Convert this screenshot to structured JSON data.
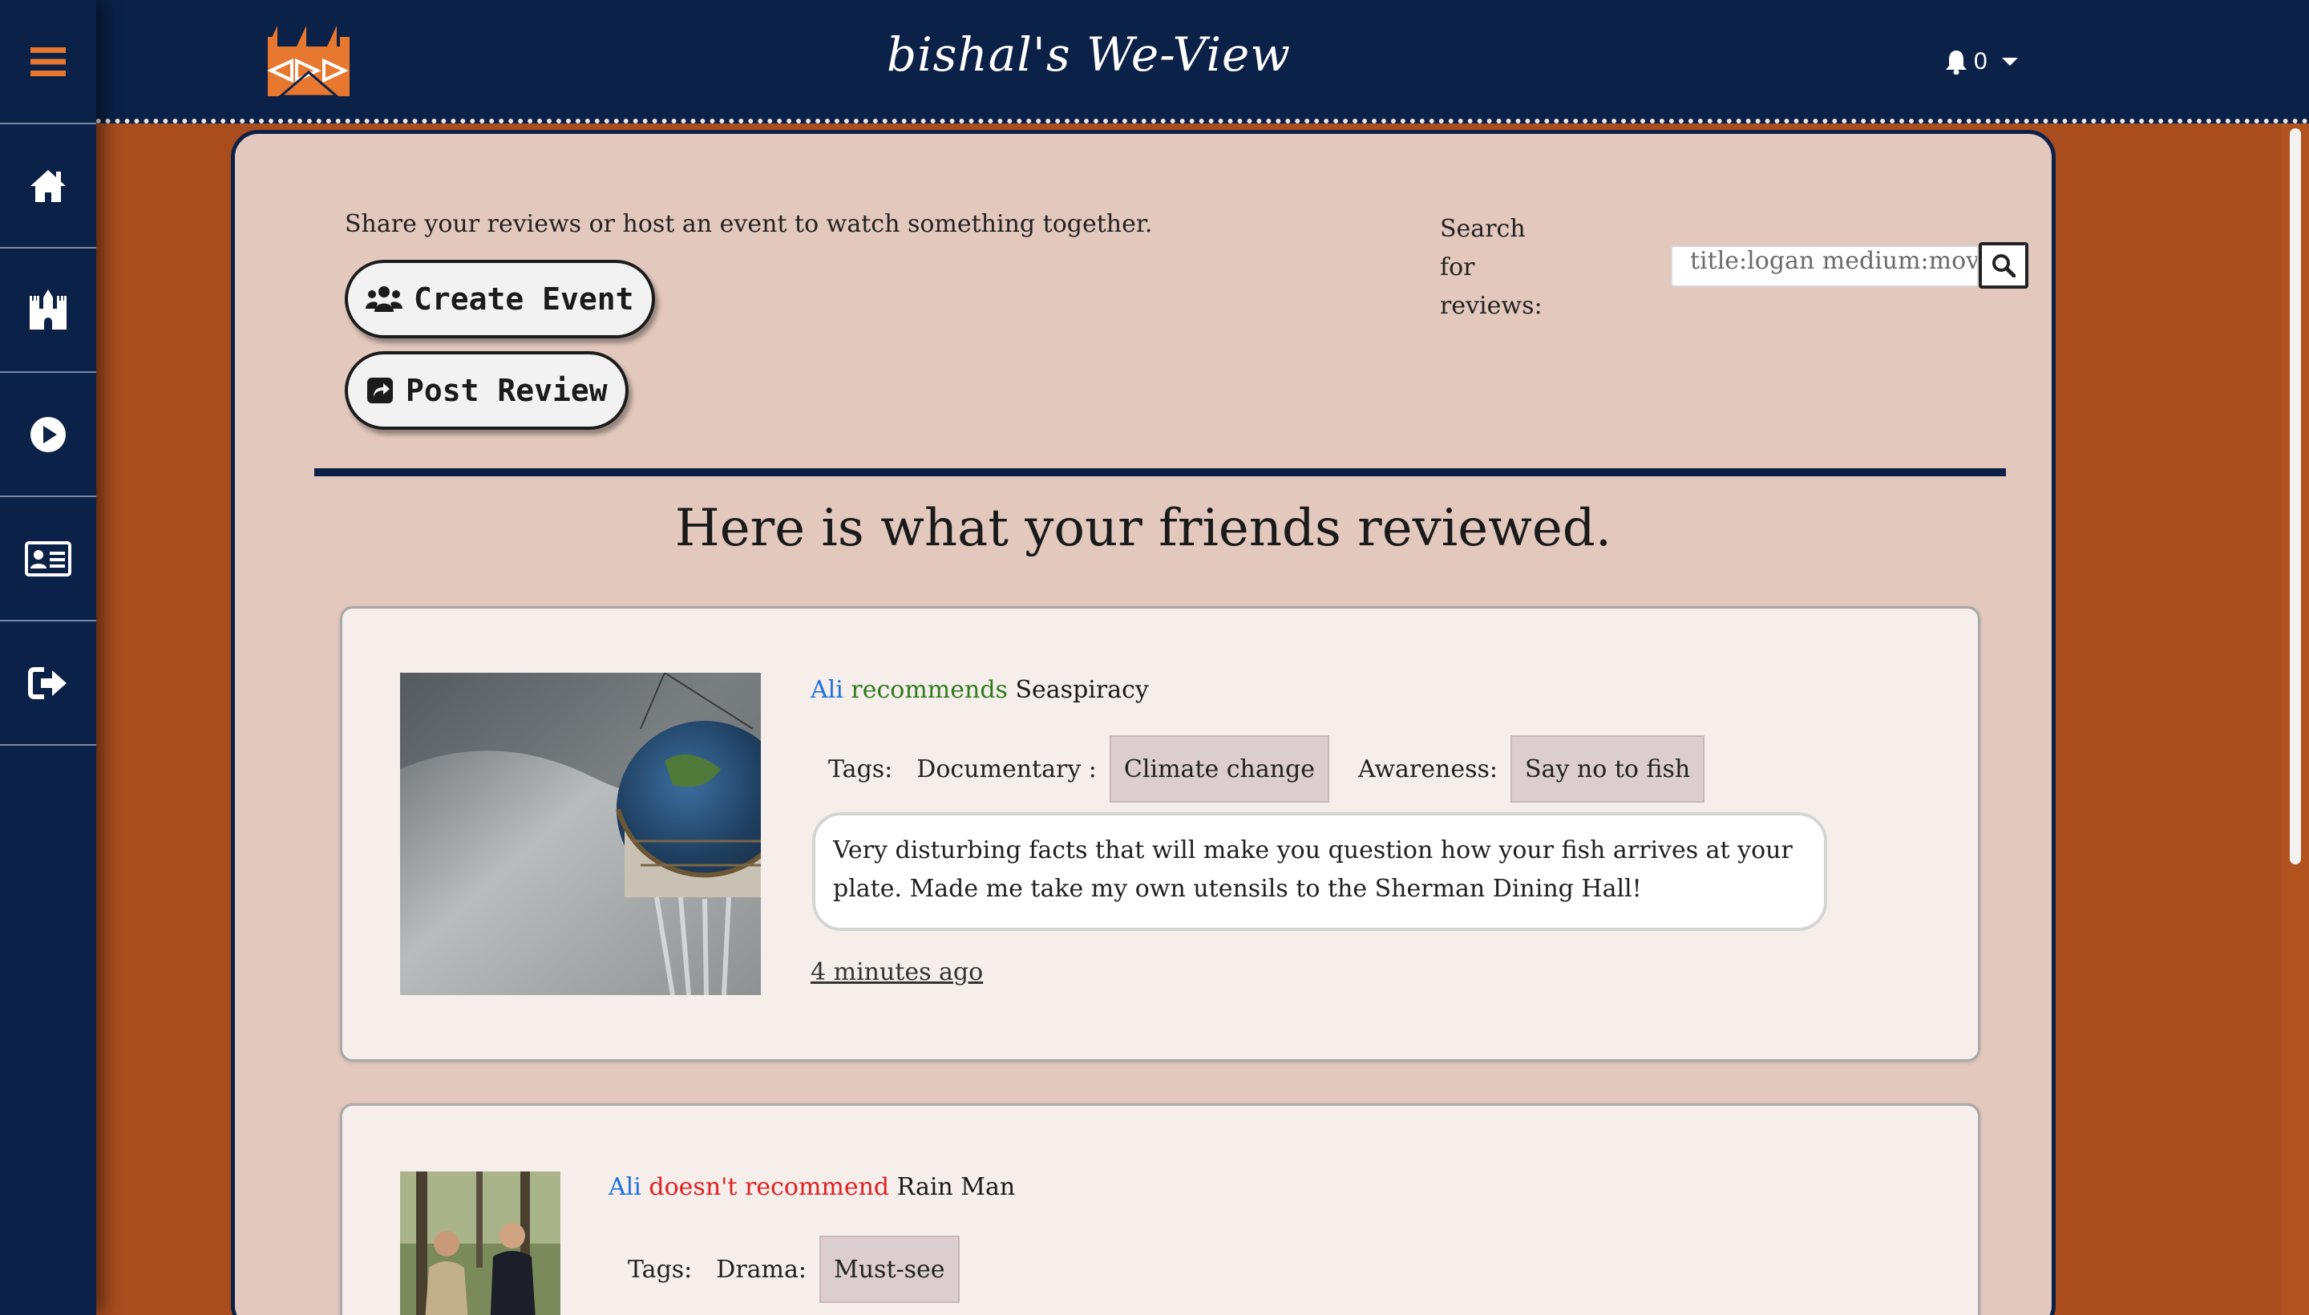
{
  "header": {
    "brand": "bishal's We-View",
    "notification_count": "0"
  },
  "sidebar": {
    "items": [
      {
        "icon": "menu-icon"
      },
      {
        "icon": "home-icon"
      },
      {
        "icon": "castle-icon"
      },
      {
        "icon": "play-icon"
      },
      {
        "icon": "id-card-icon"
      },
      {
        "icon": "sign-out-icon"
      }
    ]
  },
  "actions": {
    "intro": "Share your reviews or host an event to watch something together.",
    "create_event": "Create Event",
    "post_review": "Post Review"
  },
  "search": {
    "label": "Search for reviews:",
    "value": "title:logan medium:movie"
  },
  "feed": {
    "title": "Here is what your friends reviewed.",
    "reviews": [
      {
        "user": "Ali",
        "verdict": "recommends",
        "movie": "Seaspiracy",
        "tags_label": "Tags:",
        "tag_groups": [
          {
            "category": "Documentary :",
            "tag": "Climate change"
          },
          {
            "category": "Awareness:",
            "tag": "Say no to fish"
          }
        ],
        "comment": "Very disturbing facts that will make you question how your fish arrives at your plate. Made me take my own utensils to the Sherman Dining Hall!",
        "time": "4 minutes ago"
      },
      {
        "user": "Ali",
        "verdict": "doesn't recommend",
        "movie": "Rain Man",
        "tags_label": "Tags:",
        "tag_groups": [
          {
            "category": "Drama:",
            "tag": "Must-see"
          }
        ]
      }
    ]
  },
  "colors": {
    "navy": "#0b2147",
    "orange": "#a94d1f",
    "accent": "#e8782f",
    "recommend": "#2f7a1d",
    "not_recommend": "#e02020",
    "user_link": "#1f6fe0"
  }
}
